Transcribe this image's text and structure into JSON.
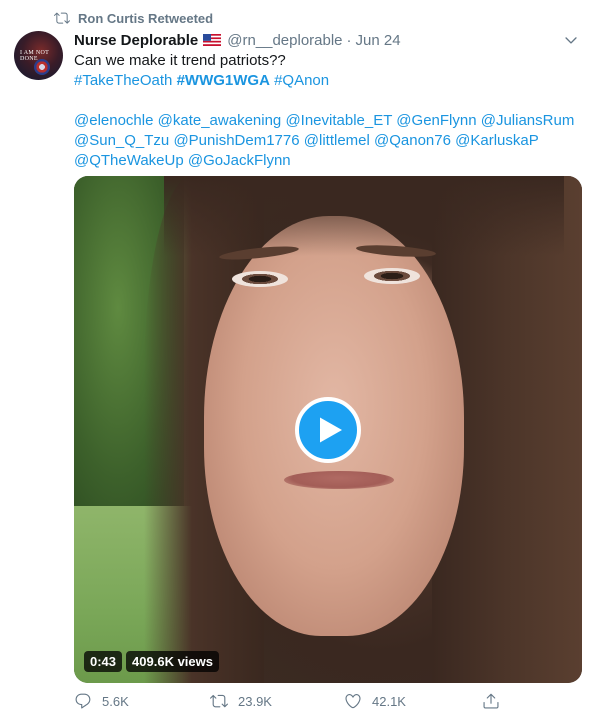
{
  "retweet": {
    "label": "Ron Curtis Retweeted",
    "icon": "retweet-icon"
  },
  "author": {
    "display_name": "Nurse Deplorable",
    "flag_icon": "us-flag-icon",
    "handle": "@rn__deplorable",
    "separator": "·",
    "date": "Jun 24",
    "avatar_text": "I AM NOT DONE"
  },
  "tweet": {
    "line1": "Can we make it trend patriots??",
    "hashtags": [
      "#TakeTheOath",
      "#WWG1WGA",
      "#QAnon"
    ],
    "mentions_line1": [
      "@elenochle",
      "@kate_awakening",
      "@Inevitable_ET",
      "@GenFlynn",
      "@JuliansRum"
    ],
    "mentions_line2": [
      "@Sun_Q_Tzu",
      "@PunishDem1776",
      "@littlemel",
      "@Qanon76",
      "@KarluskaP"
    ],
    "mentions_line3": [
      "@QTheWakeUp",
      "@GoJackFlynn"
    ]
  },
  "video": {
    "duration": "0:43",
    "views": "409.6K views",
    "play_icon": "play-icon"
  },
  "actions": {
    "reply_count": "5.6K",
    "retweet_count": "23.9K",
    "like_count": "42.1K"
  },
  "colors": {
    "link": "#1b95e0",
    "accent": "#1da1f2",
    "muted": "#657786",
    "text": "#14171a"
  }
}
